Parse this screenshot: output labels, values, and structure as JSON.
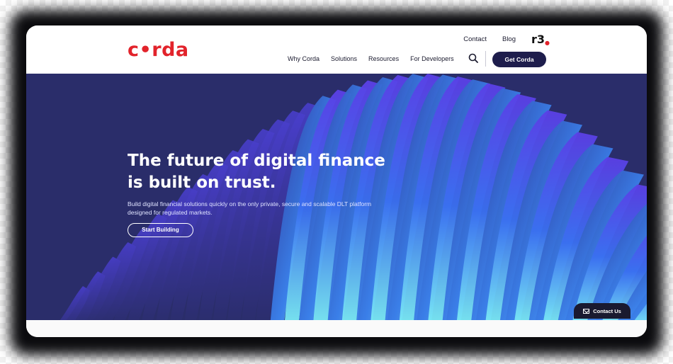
{
  "brand": {
    "logo_text": "c•rda",
    "partner_logo": "r3",
    "accent_color": "#e2232b",
    "primary_color": "#1e1d4c"
  },
  "header": {
    "top_links": [
      "Contact",
      "Blog"
    ],
    "nav": [
      "Why Corda",
      "Solutions",
      "Resources",
      "For Developers"
    ],
    "search_icon": "search-icon",
    "cta_label": "Get Corda"
  },
  "hero": {
    "title": "The future of digital finance is built on trust.",
    "subtitle": "Build digital financial solutions quickly on the only private, secure and scalable DLT platform designed for regulated markets.",
    "button_label": "Start Building"
  },
  "contact_widget": {
    "label": "Contact Us",
    "icon": "mail-icon"
  }
}
